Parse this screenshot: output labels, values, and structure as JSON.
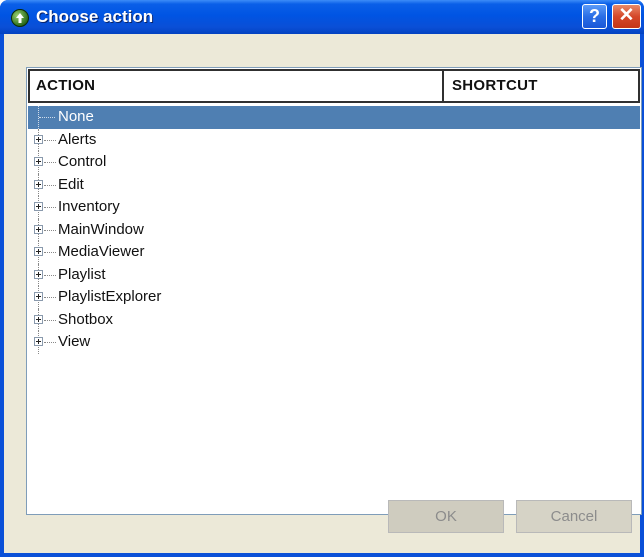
{
  "window": {
    "title": "Choose action",
    "help_label": "?",
    "close_label": "✕"
  },
  "list": {
    "columns": {
      "action": "ACTION",
      "shortcut": "SHORTCUT"
    },
    "items": [
      {
        "label": "None",
        "expandable": false,
        "selected": true
      },
      {
        "label": "Alerts",
        "expandable": true
      },
      {
        "label": "Control",
        "expandable": true
      },
      {
        "label": "Edit",
        "expandable": true
      },
      {
        "label": "Inventory",
        "expandable": true
      },
      {
        "label": "MainWindow",
        "expandable": true
      },
      {
        "label": "MediaViewer",
        "expandable": true
      },
      {
        "label": "Playlist",
        "expandable": true
      },
      {
        "label": "PlaylistExplorer",
        "expandable": true
      },
      {
        "label": "Shotbox",
        "expandable": true
      },
      {
        "label": "View",
        "expandable": true
      }
    ]
  },
  "buttons": {
    "ok": "OK",
    "cancel": "Cancel"
  },
  "colors": {
    "titlebar": "#0054e3",
    "selection": "#4f7fb2",
    "dialog_bg": "#ece9d8",
    "close": "#d5482a"
  }
}
